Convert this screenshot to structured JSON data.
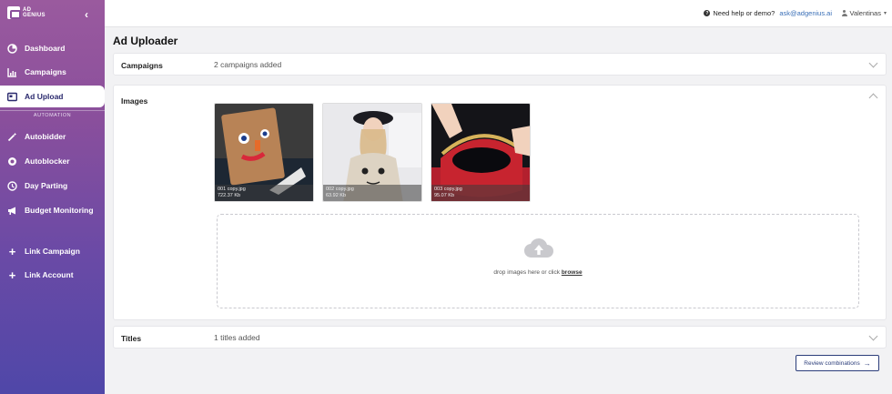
{
  "brand": {
    "line1": "AD",
    "line2": "GENIUS"
  },
  "sidebar": {
    "items": [
      {
        "label": "Dashboard",
        "icon": "dashboard-icon"
      },
      {
        "label": "Campaigns",
        "icon": "chart-icon"
      },
      {
        "label": "Ad Upload",
        "icon": "ad-upload-icon"
      },
      {
        "label": "Autobidder",
        "icon": "wand-icon"
      },
      {
        "label": "Autoblocker",
        "icon": "block-icon"
      },
      {
        "label": "Day Parting",
        "icon": "clock-icon"
      },
      {
        "label": "Budget Monitoring",
        "icon": "megaphone-icon"
      },
      {
        "label": "Link Campaign",
        "icon": "plus-icon"
      },
      {
        "label": "Link Account",
        "icon": "plus-icon"
      }
    ],
    "section_label": "AUTOMATION"
  },
  "topbar": {
    "help_text": "Need help or demo?",
    "help_email": "ask@adgenius.ai",
    "user_name": "Valentinas"
  },
  "page": {
    "title": "Ad Uploader"
  },
  "campaigns": {
    "label": "Campaigns",
    "value": "2 campaigns added"
  },
  "images": {
    "label": "Images",
    "files": [
      {
        "name": "001 copy.jpg",
        "size": "722.37 Kb"
      },
      {
        "name": "002 copy.jpg",
        "size": "63.92 Kb"
      },
      {
        "name": "003 copy.jpg",
        "size": "95.07 Kb"
      }
    ],
    "drop_text": "drop images here or click",
    "browse_label": "browse"
  },
  "titles": {
    "label": "Titles",
    "value": "1 titles added"
  },
  "review_button": "Review combinations"
}
